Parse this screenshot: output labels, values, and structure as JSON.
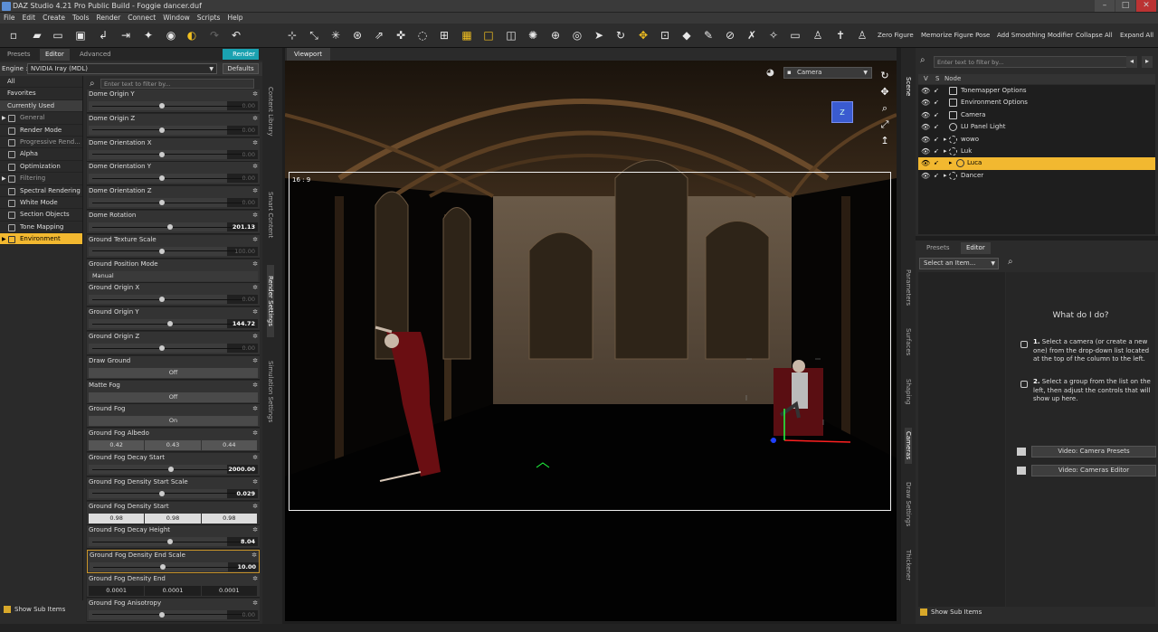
{
  "window": {
    "title": "DAZ Studio 4.21 Pro Public Build - Foggie dancer.duf"
  },
  "menu": [
    "File",
    "Edit",
    "Create",
    "Tools",
    "Render",
    "Connect",
    "Window",
    "Scripts",
    "Help"
  ],
  "toolbar": {
    "icons": [
      "new-icon",
      "open-icon",
      "open-folder-icon",
      "save-icon",
      "merge-icon",
      "export-icon",
      "figure-icon",
      "render-icon",
      "iray-icon",
      "undo-icon",
      "redo-icon"
    ],
    "buttons": {
      "zero_figure": "Zero Figure",
      "memorize_pose": "Memorize Figure Pose",
      "add_smoothing": "Add Smoothing Modifier",
      "collapse_all": "Collapse All",
      "expand_all": "Expand All"
    }
  },
  "render_panel": {
    "tabs": [
      "Presets",
      "Editor",
      "Advanced"
    ],
    "active_tab": "Editor",
    "render_button": "Render",
    "engine_label": "Engine :",
    "engine_value": "NVIDIA Iray (MDL)",
    "defaults_button": "Defaults",
    "filter_placeholder": "Enter text to filter by...",
    "categories": [
      "All",
      "Favorites",
      "Currently Used",
      "General",
      "Render Mode",
      "Progressive Rend...",
      "Alpha",
      "Optimization",
      "Filtering",
      "Spectral Rendering",
      "White Mode",
      "Section Objects",
      "Tone Mapping",
      "Environment"
    ],
    "selected_category": "Environment",
    "show_sub_items": "Show Sub Items",
    "properties": [
      {
        "label": "Dome Origin Y",
        "type": "slider",
        "value": "0.00"
      },
      {
        "label": "Dome Origin Z",
        "type": "slider",
        "value": "0.00"
      },
      {
        "label": "Dome Orientation X",
        "type": "slider",
        "value": "0.00"
      },
      {
        "label": "Dome Orientation Y",
        "type": "slider",
        "value": "0.00"
      },
      {
        "label": "Dome Orientation Z",
        "type": "slider",
        "value": "0.00"
      },
      {
        "label": "Dome Rotation",
        "type": "slider",
        "value": "201.13"
      },
      {
        "label": "Ground Texture Scale",
        "type": "slider",
        "value": "100.00"
      },
      {
        "label": "Ground Position Mode",
        "type": "select",
        "value": "Manual"
      },
      {
        "label": "Ground Origin X",
        "type": "slider",
        "value": "0.00"
      },
      {
        "label": "Ground Origin Y",
        "type": "slider",
        "value": "144.72"
      },
      {
        "label": "Ground Origin Z",
        "type": "slider",
        "value": "0.00"
      },
      {
        "label": "Draw Ground",
        "type": "toggle",
        "value": "Off"
      },
      {
        "label": "Matte Fog",
        "type": "toggle",
        "value": "Off"
      },
      {
        "label": "Ground Fog",
        "type": "toggle",
        "value": "On"
      },
      {
        "label": "Ground Fog Albedo",
        "type": "triple",
        "values": [
          "0.42",
          "0.43",
          "0.44"
        ]
      },
      {
        "label": "Ground Fog Decay Start",
        "type": "slider",
        "value": "2000.00"
      },
      {
        "label": "Ground Fog Density Start Scale",
        "type": "slider",
        "value": "0.029"
      },
      {
        "label": "Ground Fog Density Start",
        "type": "triple",
        "values": [
          "0.98",
          "0.98",
          "0.98"
        ]
      },
      {
        "label": "Ground Fog Decay Height",
        "type": "slider",
        "value": "8.04"
      },
      {
        "label": "Ground Fog Density End Scale",
        "type": "slider",
        "value": "10.00"
      },
      {
        "label": "Ground Fog Density End",
        "type": "triple",
        "values": [
          "0.0001",
          "0.0001",
          "0.0001"
        ]
      },
      {
        "label": "Ground Fog Anisotropy",
        "type": "slider",
        "value": "0.00"
      }
    ]
  },
  "side_tabs_left": [
    "Content Library",
    "Smart Content",
    "Render Settings",
    "Simulation Settings"
  ],
  "viewport": {
    "tab": "Viewport",
    "camera": "Camera",
    "aspect": "16 : 9"
  },
  "scene_panel": {
    "tab": "Scene",
    "filter_placeholder": "Enter text to filter by...",
    "header": {
      "v": "V",
      "s": "S",
      "node": "Node"
    },
    "nodes": [
      "Tonemapper Options",
      "Environment Options",
      "Camera",
      "LU Panel Light",
      "wowo",
      "Luk",
      "Luca",
      "Dancer"
    ],
    "selected_node": "Luca"
  },
  "editor_panel": {
    "tabs": [
      "Presets",
      "Editor"
    ],
    "select_item": "Select an Item...",
    "title": "What do I do?",
    "step1_num": "1.",
    "step1": "Select a camera (or create a new one) from the drop-down list located at the top of the column to the left.",
    "step2_num": "2.",
    "step2": "Select a group from the list on the left, then adjust the controls that will show up here.",
    "video1": "Video: Camera Presets",
    "video2": "Video: Cameras Editor",
    "show_sub_items": "Show Sub Items"
  },
  "side_tabs_right": [
    "Parameters",
    "Surfaces",
    "Shaping",
    "Cameras",
    "Draw Settings",
    "Thickener"
  ]
}
